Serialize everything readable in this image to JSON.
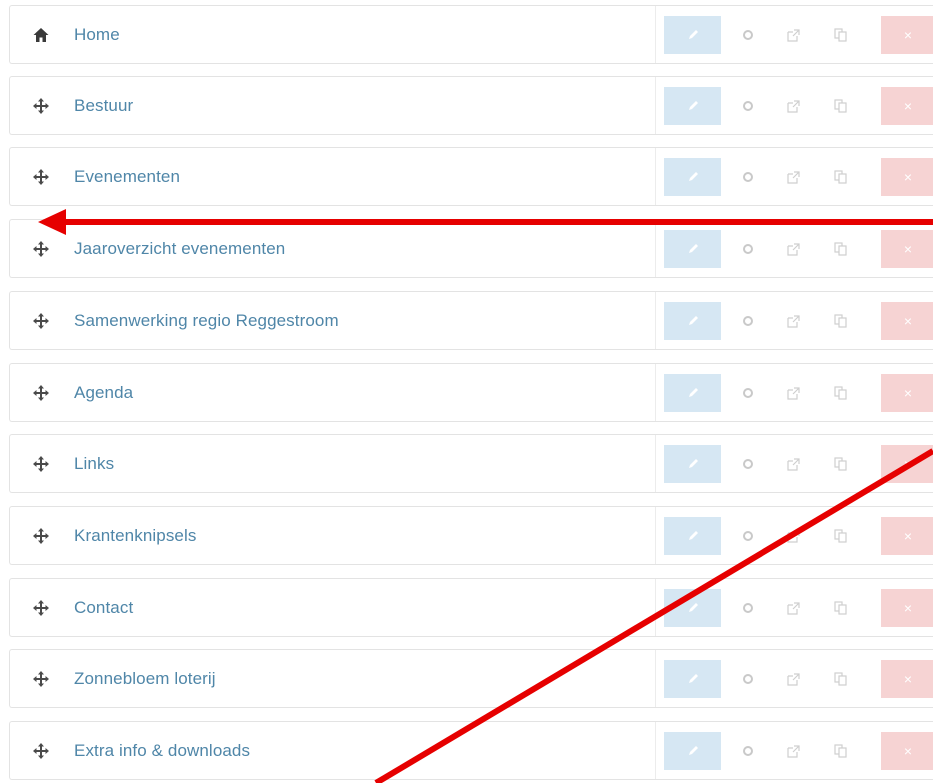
{
  "menu": {
    "items": [
      {
        "label": "Home",
        "icon": "home-icon"
      },
      {
        "label": "Bestuur",
        "icon": "move-handle-icon"
      },
      {
        "label": "Evenementen",
        "icon": "move-handle-icon"
      },
      {
        "label": "Jaaroverzicht evenementen",
        "icon": "move-handle-icon"
      },
      {
        "label": "Samenwerking regio Reggestroom",
        "icon": "move-handle-icon"
      },
      {
        "label": "Agenda",
        "icon": "move-handle-icon"
      },
      {
        "label": "Links",
        "icon": "move-handle-icon"
      },
      {
        "label": "Krantenknipsels",
        "icon": "move-handle-icon"
      },
      {
        "label": "Contact",
        "icon": "move-handle-icon"
      },
      {
        "label": "Zonnebloem loterij",
        "icon": "move-handle-icon"
      },
      {
        "label": "Extra info & downloads",
        "icon": "move-handle-icon"
      }
    ],
    "action_icons": [
      "pencil-icon",
      "gear-icon",
      "external-link-icon",
      "copy-icon",
      "close-icon"
    ],
    "delete_glyph": "×"
  },
  "colors": {
    "link": "#4f86a8",
    "edit_button": "#d6e7f3",
    "delete_button": "#f6d3d3",
    "annotation": "#e60000"
  }
}
